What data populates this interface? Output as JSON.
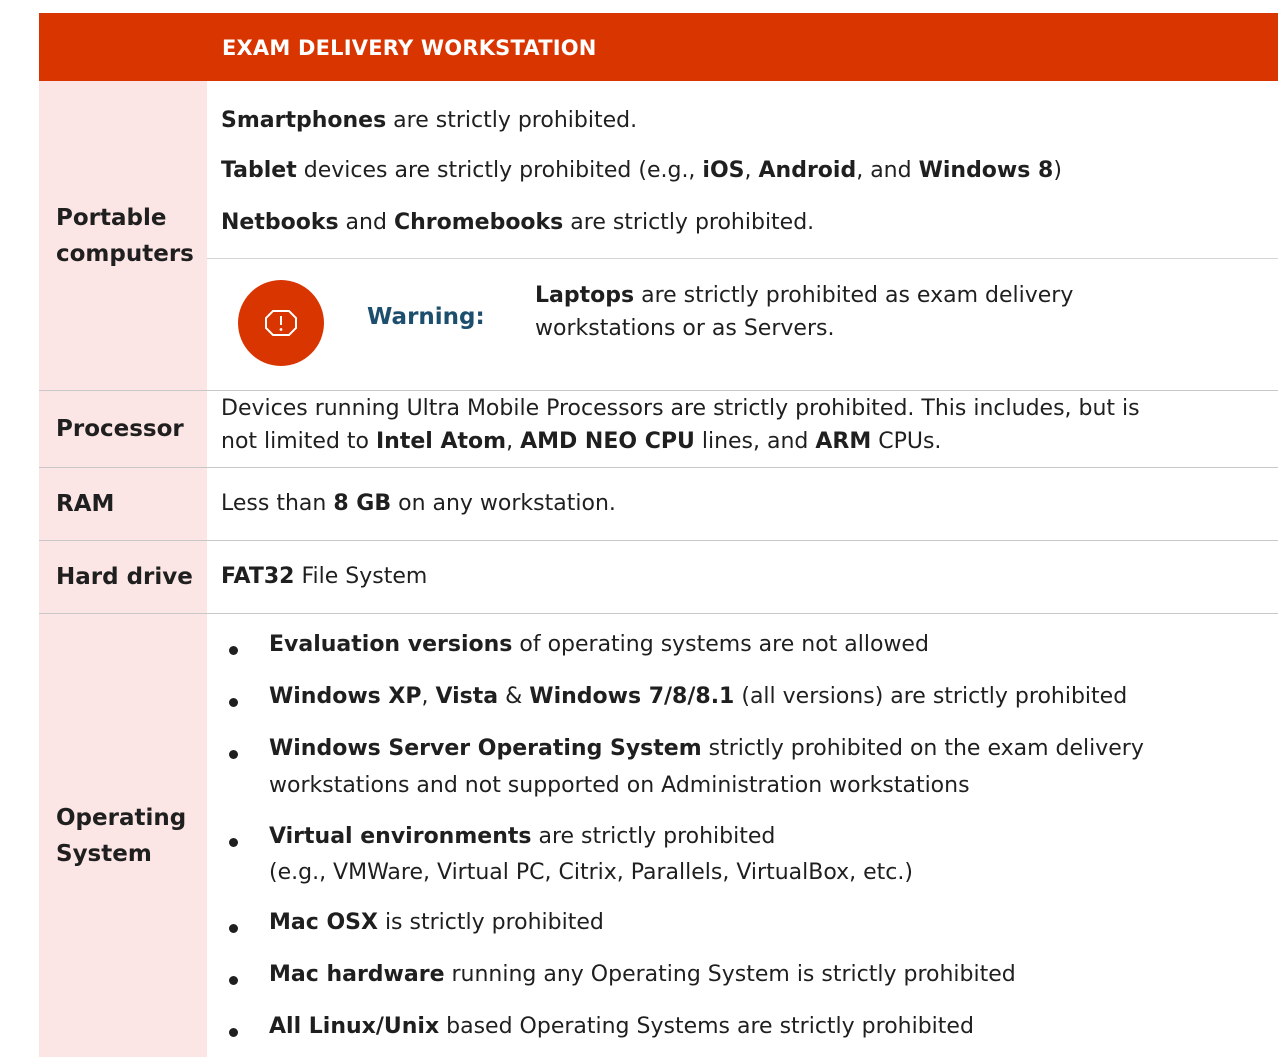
{
  "header": {
    "title": "EXAM DELIVERY WORKSTATION"
  },
  "colors": {
    "header_bg": "#d93500",
    "label_bg": "#fce5e5",
    "warning_text": "#1c4e6e",
    "icon": "#d93500"
  },
  "portable": {
    "label": "Portable computers",
    "lines": [
      [
        {
          "b": "Smartphones"
        },
        {
          "t": " are strictly prohibited."
        }
      ],
      [
        {
          "b": "Tablet"
        },
        {
          "t": " devices are strictly prohibited (e.g., "
        },
        {
          "b": "iOS"
        },
        {
          "t": ", "
        },
        {
          "b": "Android"
        },
        {
          "t": ", and "
        },
        {
          "b": "Windows 8"
        },
        {
          "t": ")"
        }
      ],
      [
        {
          "b": "Netbooks"
        },
        {
          "t": " and "
        },
        {
          "b": "Chromebooks"
        },
        {
          "t": " are strictly prohibited."
        }
      ]
    ],
    "warning": {
      "icon": "alert-octagon-icon",
      "label": "Warning:",
      "lines": [
        [
          {
            "b": "Laptops"
          },
          {
            "t": " are strictly prohibited as exam delivery"
          }
        ],
        [
          {
            "t": "workstations or as Servers."
          }
        ]
      ]
    }
  },
  "processor": {
    "label": "Processor",
    "lines": [
      [
        {
          "t": "Devices running Ultra Mobile Processors are strictly prohibited. This includes, but is"
        }
      ],
      [
        {
          "t": "not limited to "
        },
        {
          "b": "Intel Atom"
        },
        {
          "t": ", "
        },
        {
          "b": "AMD NEO CPU"
        },
        {
          "t": " lines, and "
        },
        {
          "b": "ARM"
        },
        {
          "t": " CPUs."
        }
      ]
    ]
  },
  "ram": {
    "label": "RAM",
    "lines": [
      [
        {
          "t": "Less than "
        },
        {
          "b": "8 GB"
        },
        {
          "t": " on any workstation."
        }
      ]
    ]
  },
  "hard_drive": {
    "label": "Hard drive",
    "lines": [
      [
        {
          "b": "FAT32"
        },
        {
          "t": " File System"
        }
      ]
    ]
  },
  "os": {
    "label": "Operating System",
    "bullets": [
      [
        [
          {
            "b": "Evaluation versions"
          },
          {
            "t": " of operating systems are not allowed"
          }
        ]
      ],
      [
        [
          {
            "b": "Windows XP"
          },
          {
            "t": ", "
          },
          {
            "b": "Vista"
          },
          {
            "t": " & "
          },
          {
            "b": "Windows 7/8/8.1"
          },
          {
            "t": " (all versions) are strictly prohibited"
          }
        ]
      ],
      [
        [
          {
            "b": "Windows Server Operating System"
          },
          {
            "t": " strictly prohibited on the exam delivery"
          }
        ],
        [
          {
            "t": "workstations and not supported on Administration workstations"
          }
        ]
      ],
      [
        [
          {
            "b": "Virtual environments"
          },
          {
            "t": " are strictly prohibited"
          }
        ],
        [
          {
            "t": "(e.g., VMWare, Virtual PC, Citrix, Parallels, VirtualBox, etc.)"
          }
        ]
      ],
      [
        [
          {
            "b": "Mac OSX"
          },
          {
            "t": " is strictly prohibited"
          }
        ]
      ],
      [
        [
          {
            "b": "Mac hardware"
          },
          {
            "t": " running any Operating System is strictly prohibited"
          }
        ]
      ],
      [
        [
          {
            "b": "All Linux/Unix"
          },
          {
            "t": " based Operating Systems are strictly prohibited"
          }
        ]
      ]
    ]
  }
}
